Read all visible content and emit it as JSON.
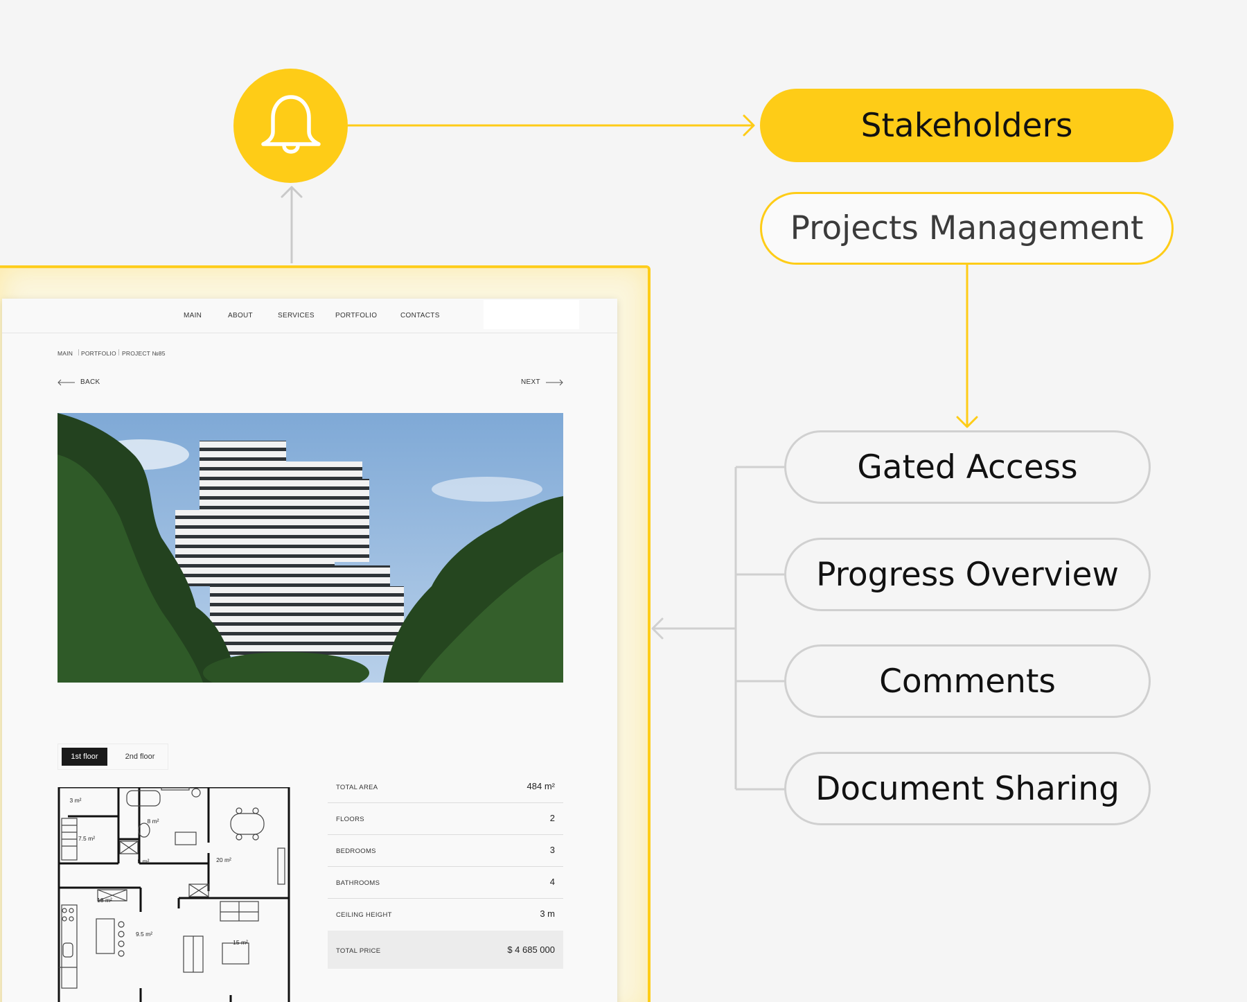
{
  "diagram": {
    "trigger": {
      "icon": "bell-icon",
      "accent": "#fecc17"
    },
    "stakeholders": {
      "label": "Stakeholders"
    },
    "projects_management": {
      "label": "Projects Management"
    },
    "features": [
      {
        "label": "Gated Access"
      },
      {
        "label": "Progress Overview"
      },
      {
        "label": "Comments"
      },
      {
        "label": "Document Sharing"
      }
    ]
  },
  "website": {
    "nav": [
      "MAIN",
      "ABOUT",
      "SERVICES",
      "PORTFOLIO",
      "CONTACTS"
    ],
    "breadcrumb": [
      "MAIN",
      "PORTFOLIO",
      "PROJECT №85"
    ],
    "back_label": "BACK",
    "next_label": "NEXT",
    "floor_tabs": [
      "1st floor",
      "2nd floor"
    ],
    "room_areas": [
      "3 m²",
      "8 m²",
      "7.5 m²",
      "5 m²",
      "20 m²",
      "18 m²",
      "9.5 m²",
      "15 m²"
    ],
    "specs": [
      {
        "label": "TOTAL AREA",
        "value": "484 m²"
      },
      {
        "label": "FLOORS",
        "value": "2"
      },
      {
        "label": "BEDROOMS",
        "value": "3"
      },
      {
        "label": "BATHROOMS",
        "value": "4"
      },
      {
        "label": "CEILING HEIGHT",
        "value": "3 m"
      }
    ],
    "total": {
      "label": "TOTAL PRICE",
      "value": "$ 4 685 000"
    }
  }
}
